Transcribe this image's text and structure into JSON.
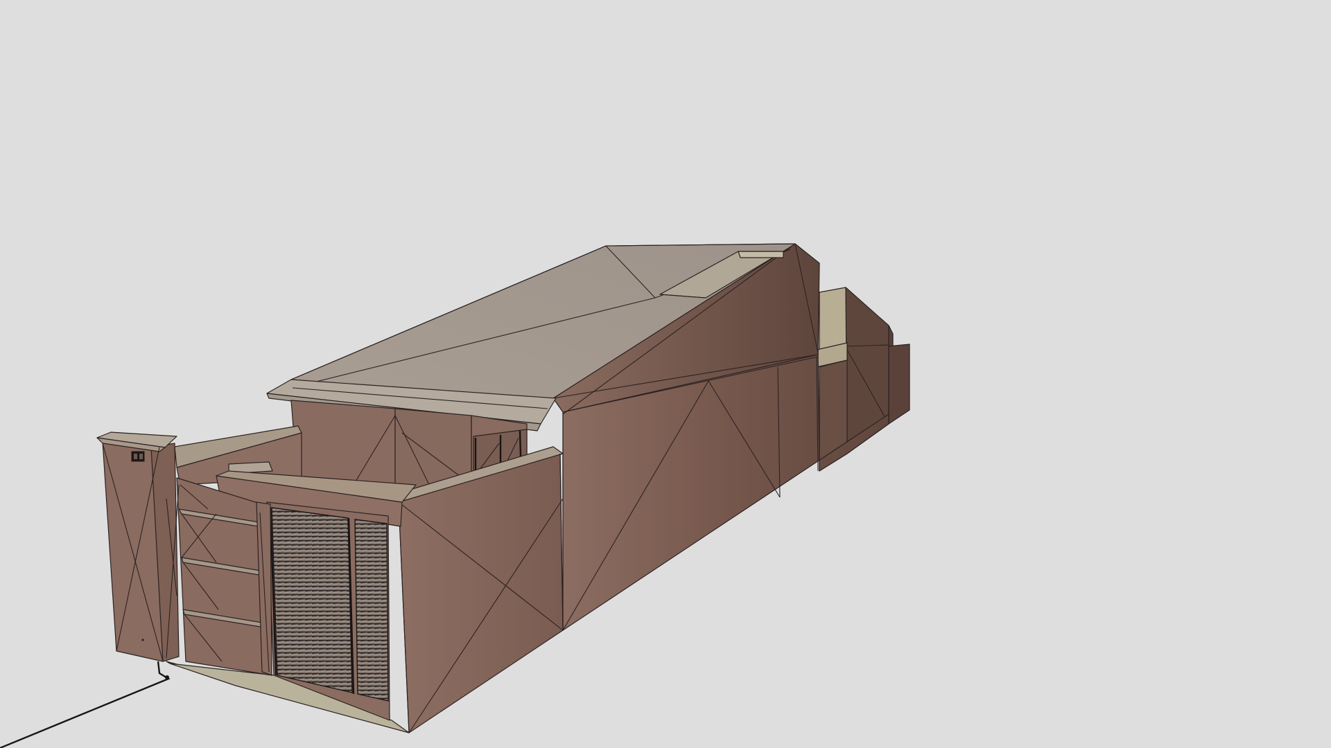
{
  "scene": {
    "description_label": "",
    "background_color": "#dedede",
    "wall_light_color": "#8c6d61",
    "wall_dark_color": "#5f463d",
    "roof_color": "#a59b90",
    "ground_color": "#b8b4a0",
    "edge_color": "#2b2222"
  }
}
